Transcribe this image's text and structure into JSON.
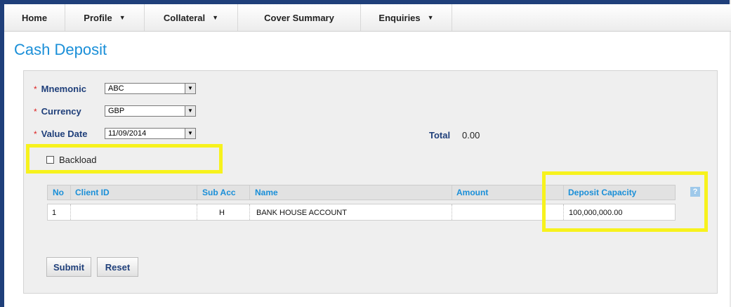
{
  "nav": {
    "items": [
      {
        "label": "Home",
        "has_menu": false
      },
      {
        "label": "Profile",
        "has_menu": true
      },
      {
        "label": "Collateral",
        "has_menu": true
      },
      {
        "label": "Cover Summary",
        "has_menu": false
      },
      {
        "label": "Enquiries",
        "has_menu": true
      }
    ],
    "caret": "▼"
  },
  "page": {
    "title": "Cash Deposit"
  },
  "form": {
    "required_marker": "*",
    "mnemonic": {
      "label": "Mnemonic",
      "value": "ABC"
    },
    "currency": {
      "label": "Currency",
      "value": "GBP"
    },
    "value_date": {
      "label": "Value Date",
      "value": "11/09/2014"
    },
    "total": {
      "label": "Total",
      "value": "0.00"
    },
    "backload": {
      "label": "Backload",
      "checked": false
    }
  },
  "grid": {
    "headers": [
      "No",
      "Client ID",
      "Sub Acc",
      "Name",
      "Amount",
      "Deposit Capacity"
    ],
    "rows": [
      {
        "no": "1",
        "client_id": "",
        "sub_acc": "H",
        "name": "BANK HOUSE ACCOUNT",
        "amount": "",
        "deposit_capacity": "100,000,000.00"
      }
    ],
    "help_glyph": "?"
  },
  "buttons": {
    "submit": "Submit",
    "reset": "Reset"
  },
  "colors": {
    "title": "#1a8fd8",
    "label": "#1f3f7a",
    "highlight": "#f7f21d",
    "frame": "#1f3f7a"
  },
  "icons": {
    "dropdown": "chevron-down-icon",
    "help": "help-icon"
  }
}
